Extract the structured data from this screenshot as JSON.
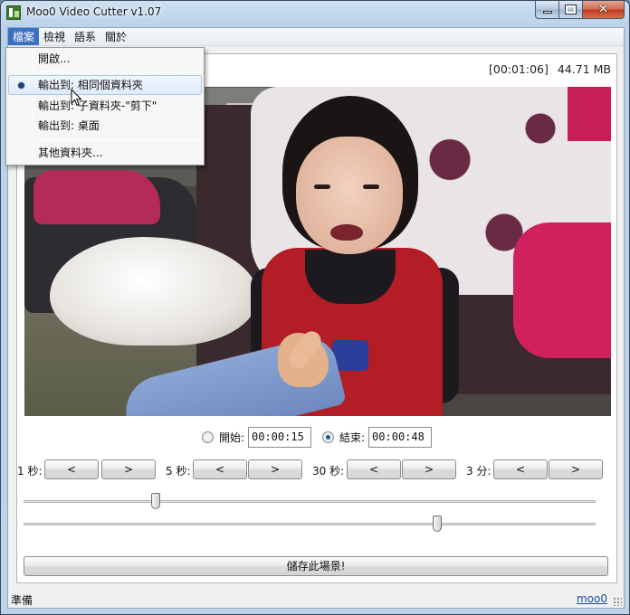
{
  "window": {
    "title": "Moo0 Video Cutter v1.07",
    "close_glyph": "✕"
  },
  "menu": {
    "items": [
      "檔案",
      "檢視",
      "語系",
      "關於"
    ],
    "active_index": 0
  },
  "file_menu": {
    "open": "開啟...",
    "out_same": "輸出到: 相同個資料夾",
    "out_subfolder": "輸出到: 子資料夾-\"剪下\"",
    "out_desktop": "輸出到: 桌面",
    "other_folder": "其他資料夾..."
  },
  "video_info": {
    "duration": "[00:01:06]",
    "size": "44.71 MB"
  },
  "range": {
    "start_label": "開始:",
    "start_value": "00:00:15",
    "end_label": "結束:",
    "end_value": "00:00:48",
    "selected": "end"
  },
  "steps": {
    "labels": [
      "1 秒:",
      "5 秒:",
      "30 秒:",
      "3 分:"
    ],
    "back": "<",
    "forward": ">"
  },
  "sliders": {
    "start_fraction": 0.227,
    "end_fraction": 0.727
  },
  "save_button": "儲存此場景!",
  "status": {
    "text": "準備",
    "link": "moo0"
  },
  "icons": {
    "app": "moo0-app-icon",
    "minimize": "minimize-icon",
    "maximize": "maximize-icon",
    "close": "close-icon"
  },
  "colors": {
    "menu_active": "#3b6fc2",
    "link": "#1a4fa8"
  }
}
